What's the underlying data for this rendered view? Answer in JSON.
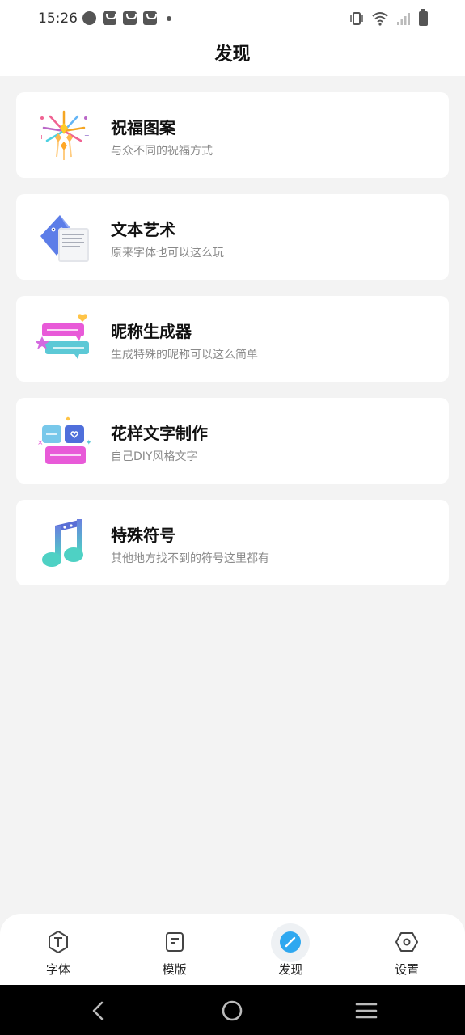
{
  "status_bar": {
    "time": "15:26"
  },
  "header": {
    "title": "发现"
  },
  "cards": [
    {
      "title": "祝福图案",
      "subtitle": "与众不同的祝福方式",
      "icon": "fireworks-icon"
    },
    {
      "title": "文本艺术",
      "subtitle": "原来字体也可以这么玩",
      "icon": "text-art-envelope-icon"
    },
    {
      "title": "昵称生成器",
      "subtitle": "生成特殊的昵称可以这么简单",
      "icon": "nickname-bubbles-icon"
    },
    {
      "title": "花样文字制作",
      "subtitle": "自己DIY风格文字",
      "icon": "fancy-text-stickers-icon"
    },
    {
      "title": "特殊符号",
      "subtitle": "其他地方找不到的符号这里都有",
      "icon": "music-note-icon"
    }
  ],
  "tab_bar": {
    "active": "发现",
    "items": [
      {
        "label": "字体",
        "icon": "font-t-icon"
      },
      {
        "label": "模版",
        "icon": "template-doc-icon"
      },
      {
        "label": "发现",
        "icon": "discover-compass-icon"
      },
      {
        "label": "设置",
        "icon": "settings-hexagon-icon"
      }
    ]
  },
  "colors": {
    "background": "#f3f3f3",
    "card": "#ffffff",
    "accent": "#2fa8f0",
    "text_primary": "#111111",
    "text_secondary": "#8a8a8a"
  }
}
